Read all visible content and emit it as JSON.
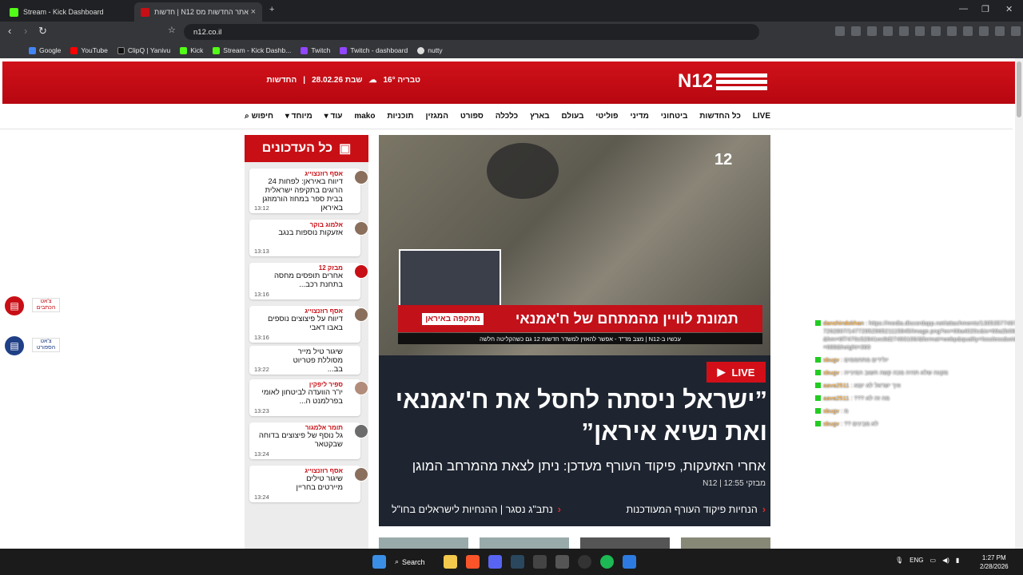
{
  "tabs": [
    {
      "title": "Stream - Kick Dashboard",
      "color": "#53fc18"
    },
    {
      "title": "חדשות | N12 אתר החדשות מס",
      "color": "#c80f15"
    }
  ],
  "new_tab": "+",
  "url": "n12.co.il",
  "bookmarks": [
    {
      "label": "Google",
      "color": "#4285f4"
    },
    {
      "label": "YouTube",
      "color": "#ff0000"
    },
    {
      "label": "ClipQ | Yanivu",
      "color": "#111"
    },
    {
      "label": "Kick",
      "color": "#53fc18"
    },
    {
      "label": "Stream - Kick Dashb...",
      "color": "#53fc18"
    },
    {
      "label": "Twitch",
      "color": "#9146ff"
    },
    {
      "label": "Twitch - dashboard",
      "color": "#9146ff"
    },
    {
      "label": "nutty",
      "color": "#ddd"
    }
  ],
  "header": {
    "logo": "N12",
    "city": "טבריה 16°",
    "date": "שבת 28.02.26",
    "section": "החדשות"
  },
  "nav": [
    "LIVE",
    "כל החדשות",
    "ביטחוני",
    "מדיני",
    "פוליטי",
    "בעולם",
    "בארץ",
    "כלכלה",
    "ספורט",
    "המגזין",
    "תוכניות",
    "mako",
    "עוד",
    "מיוחד",
    "חיפוש"
  ],
  "updates": {
    "title": "כל העדכונים",
    "items": [
      {
        "author": "אסף רוזנצוייג",
        "text": "דיווח באיראן: לפחות 24 הרוגים בתקיפה ישראלית בבית ספר במחוז הורמוזגן באיראן",
        "time": "13:12"
      },
      {
        "author": "אלמוג בוקר",
        "text": "אזעקות נוספות בנגב",
        "time": "13:13"
      },
      {
        "author": "מבזק 12",
        "text": "אחרים תופסים מחסה בתחנת רכב...",
        "time": "13:16"
      },
      {
        "author": "אסף רוזנצוייג",
        "text": "דיווח על פיצוצים נוספים באבו דאבי",
        "time": "13:16"
      },
      {
        "author": "",
        "text": "שיגור טיל מייר מסוללת פטריוט בב...",
        "time": "13:22"
      },
      {
        "author": "ספיר ליפקין",
        "text": "יו\"ר הוועדה לביטחון לאומי בפרלמנט ה...",
        "time": "13:23"
      },
      {
        "author": "תומר אלמגור",
        "text": "גל נוסף של פיצוצים בדוחה שבקטאר",
        "time": "13:24"
      },
      {
        "author": "אסף רוזנצוייג",
        "text": "שיגור טילים מיירטים בחריין",
        "time": "13:24"
      }
    ]
  },
  "hero": {
    "banner": "תמונת לוויין מהמתחם של ח'אמנאי",
    "ticker": "עכשיו ב-N12 | מצב מד\"ד - אפשר להאזין למשדר חדשות 12 גם כשהקליטה חלשה",
    "badge": "מתקפה באיראן",
    "wm": "12"
  },
  "story": {
    "live": "LIVE",
    "headline": "”ישראל ניסתה לחסל את ח'אמנאי ואת נשיא איראן”",
    "sub": "אחרי האזעקות, פיקוד העורף מעדכן: ניתן לצאת מהמרחב המוגן",
    "meta": "מבזקי N12 | 12:55",
    "related": [
      "הנחיות פיקוד העורף המעודכנות",
      "נתב\"ג נסגר | ההנחיות לישראלים בחו\"ל"
    ]
  },
  "side": {
    "chat1": "צ'אט הכתבים",
    "chat2": "צ'אט הספורט"
  },
  "overlay": [
    {
      "name": "danshindokhan",
      "msg": ": https://media.discordapp.net/attachments/1305357749767262807/1477295296521115845/image.png?ex=69a4020c&is=69a2b08c&hm=6f7470c52841ec8d27493106/&format=webp&quality=lossless&width=688&height=360"
    },
    {
      "name": "sbugv",
      "msg": ": יולידים מתחממים"
    },
    {
      "name": "sbugv",
      "msg": ": מקווה שלא תהיה מכה קשה חשוב המינייה"
    },
    {
      "name": "aava2511",
      "msg": ": איך ישראל לא יוצא"
    },
    {
      "name": "aava2511",
      "msg": ": ??? מה זה לא"
    },
    {
      "name": "sbugv",
      "msg": ": מ"
    },
    {
      "name": "sbugv",
      "msg": ": ?? לא מבינים"
    }
  ],
  "taskbar": {
    "search": "Search",
    "lang": "ENG",
    "time": "1:27 PM",
    "date": "2/28/2026"
  }
}
